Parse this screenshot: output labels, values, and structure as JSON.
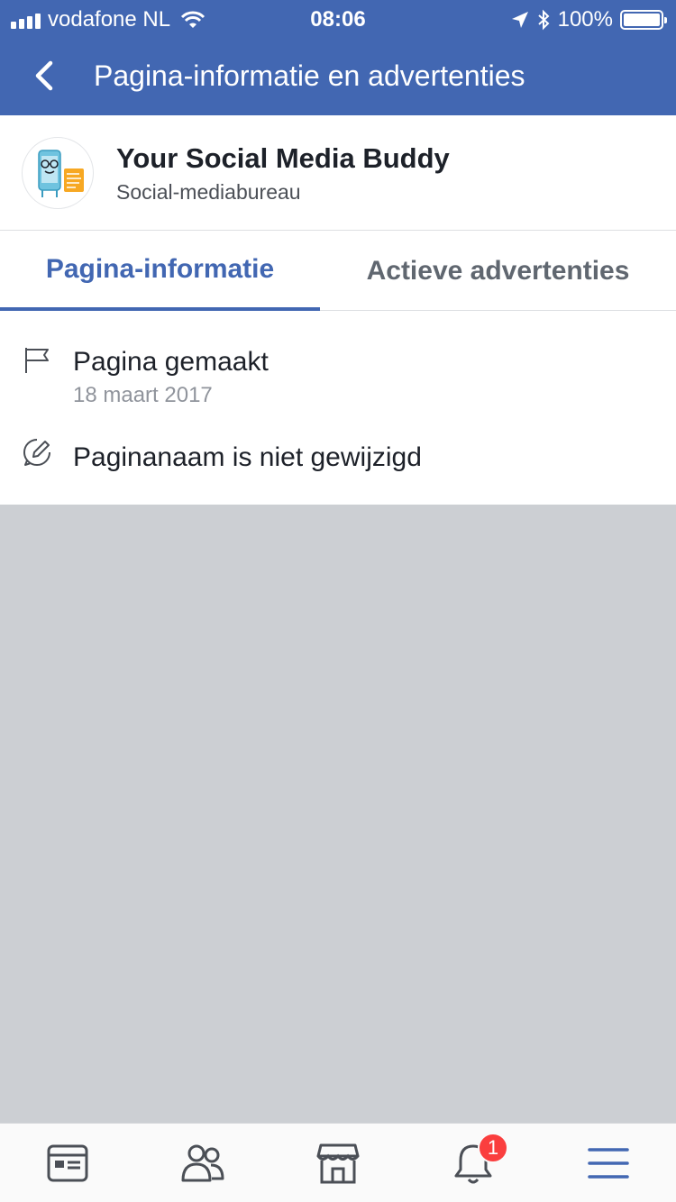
{
  "status": {
    "carrier": "vodafone NL",
    "time": "08:06",
    "battery": "100%"
  },
  "navbar": {
    "title": "Pagina-informatie en advertenties"
  },
  "page": {
    "name": "Your Social Media Buddy",
    "category": "Social-mediabureau",
    "logo_text": "Your Social Media Buddy"
  },
  "tabs": [
    {
      "label": "Pagina-informatie",
      "active": true
    },
    {
      "label": "Actieve advertenties",
      "active": false
    }
  ],
  "info": {
    "created_title": "Pagina gemaakt",
    "created_date": "18 maart 2017",
    "name_change": "Paginanaam is niet gewijzigd"
  },
  "tabbar": {
    "notifications_badge": "1",
    "icons": [
      "news-feed-icon",
      "friends-icon",
      "marketplace-icon",
      "notifications-icon",
      "menu-icon"
    ]
  },
  "colors": {
    "brand": "#4267b2",
    "badge": "#fa3e3e",
    "background": "#cccfd3"
  }
}
